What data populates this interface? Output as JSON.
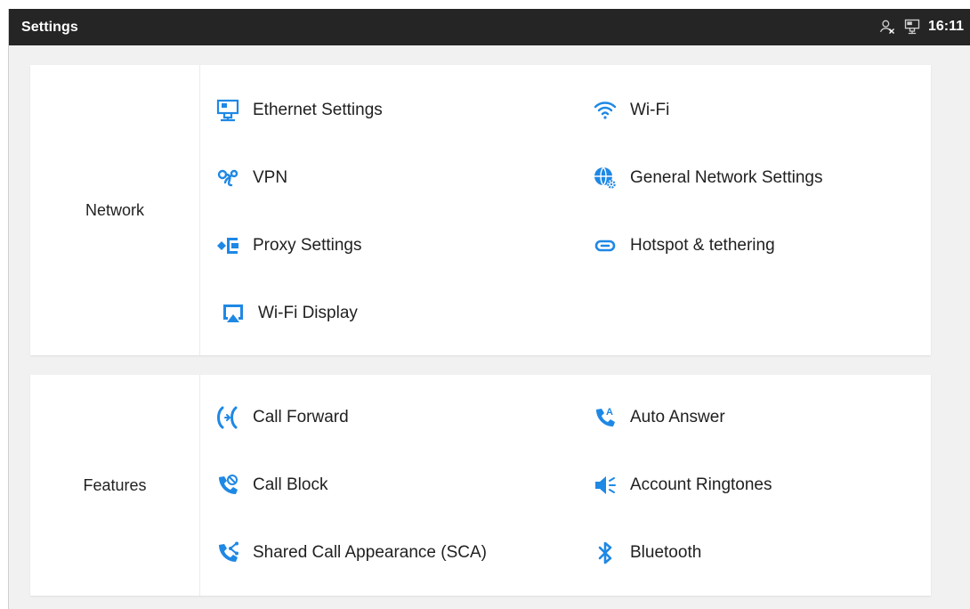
{
  "statusbar": {
    "title": "Settings",
    "time": "16:11",
    "icons": [
      "account-off-icon",
      "ethernet-icon"
    ]
  },
  "accent_color": "#1e88e5",
  "sections": {
    "network": {
      "label": "Network",
      "items": {
        "ethernet": {
          "label": "Ethernet Settings",
          "icon": "ethernet-icon"
        },
        "wifi": {
          "label": "Wi-Fi",
          "icon": "wifi-icon"
        },
        "vpn": {
          "label": "VPN",
          "icon": "vpn-icon"
        },
        "general": {
          "label": "General Network Settings",
          "icon": "globe-gear-icon"
        },
        "proxy": {
          "label": "Proxy Settings",
          "icon": "proxy-icon"
        },
        "hotspot": {
          "label": "Hotspot & tethering",
          "icon": "hotspot-icon"
        },
        "wifi_display": {
          "label": "Wi-Fi Display",
          "icon": "cast-icon"
        }
      }
    },
    "features": {
      "label": "Features",
      "items": {
        "call_forward": {
          "label": "Call Forward",
          "icon": "call-forward-icon"
        },
        "auto_answer": {
          "label": "Auto Answer",
          "icon": "auto-answer-icon"
        },
        "call_block": {
          "label": "Call Block",
          "icon": "call-block-icon"
        },
        "ringtones": {
          "label": "Account Ringtones",
          "icon": "speaker-icon"
        },
        "sca": {
          "label": "Shared Call Appearance (SCA)",
          "icon": "shared-call-icon"
        },
        "bluetooth": {
          "label": "Bluetooth",
          "icon": "bluetooth-icon"
        }
      }
    }
  }
}
